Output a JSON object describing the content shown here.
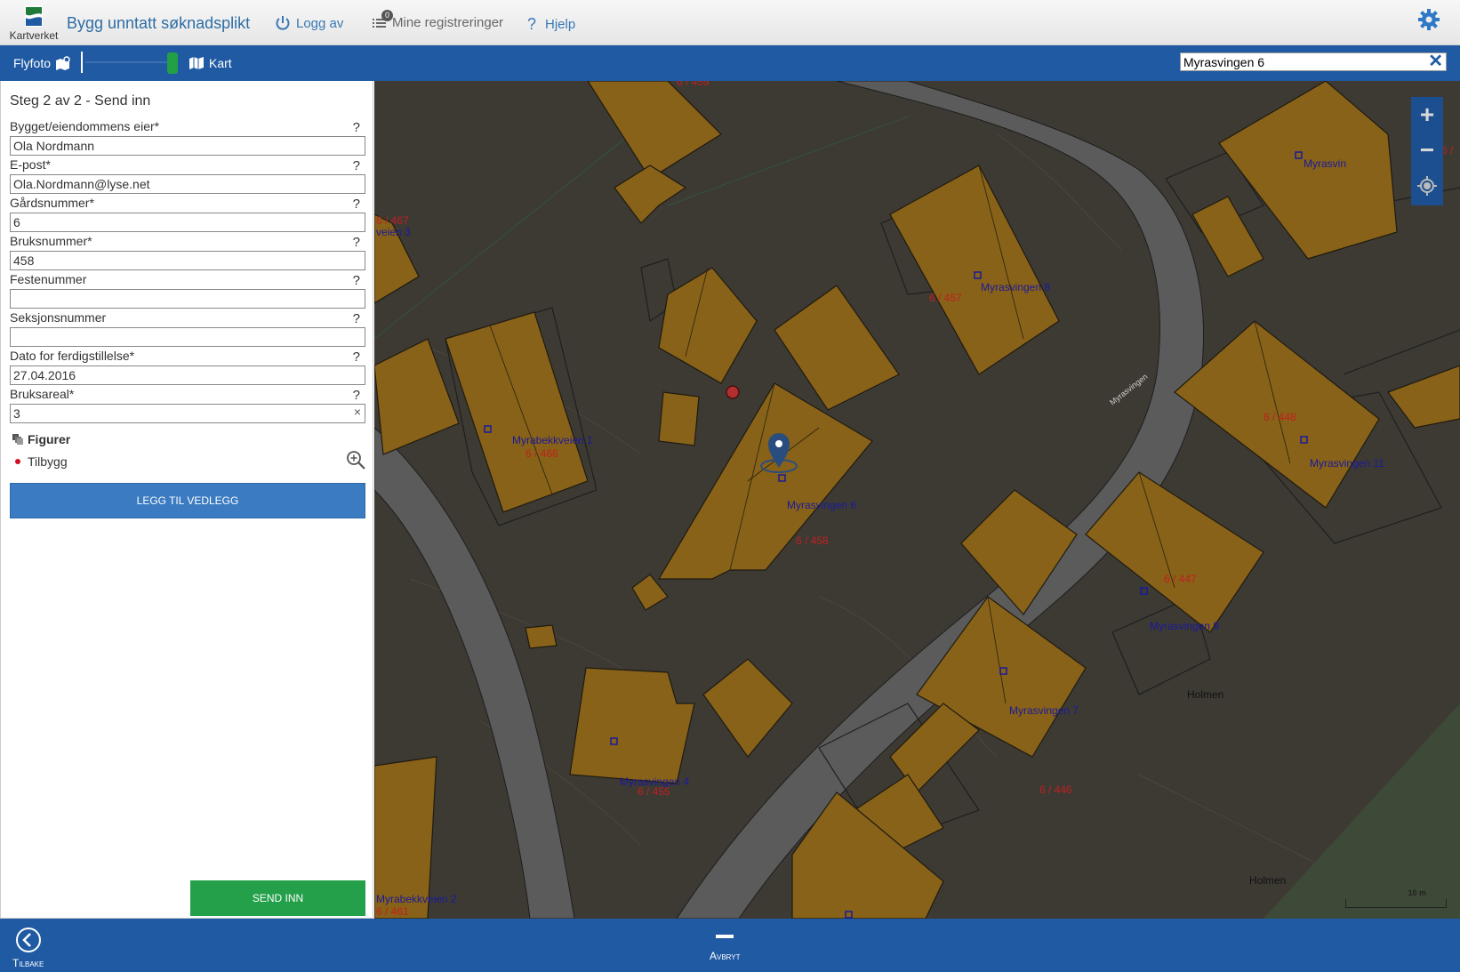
{
  "header": {
    "logo_text": "Kartverket",
    "app_title": "Bygg unntatt søknadsplikt",
    "nav": {
      "logout": "Logg av",
      "registrations": "Mine registreringer",
      "registrations_count": "0",
      "help": "Hjelp"
    }
  },
  "toolbar": {
    "flyfoto": "Flyfoto",
    "kart": "Kart",
    "search_value": "Myrasvingen 6"
  },
  "form": {
    "step_title": "Steg 2 av 2 - Send inn",
    "fields": [
      {
        "label": "Bygget/eiendommens eier*",
        "value": "Ola Nordmann"
      },
      {
        "label": "E-post*",
        "value": "Ola.Nordmann@lyse.net"
      },
      {
        "label": "Gårdsnummer*",
        "value": "6"
      },
      {
        "label": "Bruksnummer*",
        "value": "458"
      },
      {
        "label": "Festenummer",
        "value": ""
      },
      {
        "label": "Seksjonsnummer",
        "value": ""
      },
      {
        "label": "Dato for ferdigstillelse*",
        "value": "27.04.2016"
      },
      {
        "label": "Bruksareal*",
        "value": "3"
      }
    ],
    "help_mark": "?",
    "clear_mark": "×",
    "figures_title": "Figurer",
    "figure_item": "Tilbygg",
    "attach_button": "LEGG TIL VEDLEGG",
    "send_button": "SEND INN"
  },
  "map": {
    "labels": {
      "l1": "6 / 459",
      "l2": "6 / 467",
      "l3": "veien 3",
      "l4": "Myrasvingen 8",
      "l5": "6 / 457",
      "l6": "Myrasvin",
      "l7": "6 /",
      "l8": "Myrabekkveien 1",
      "l9": "6 / 466",
      "l10": "Myrasvingen",
      "l11": "6 / 448",
      "l12": "Myrasvingen 11",
      "l13": "Myrasvingen 6",
      "l14": "6 / 458",
      "l15": "6 / 447",
      "l16": "Myrasvingen 9",
      "l17": "Holmen",
      "l18": "Myrasvingen 7",
      "l19": "Myrasvingen 4",
      "l20": "6 / 455",
      "l21": "6 / 446",
      "l22": "Holmen",
      "l23": "Myrabekkveien 2",
      "l24": "6 / 461"
    },
    "zoom_in": "+",
    "zoom_out": "−",
    "scale_label": "10 m"
  },
  "bottom": {
    "back": "Tilbake",
    "cancel": "Avbryt"
  },
  "colors": {
    "brand_blue": "#1f5aa3",
    "send_green": "#24a04a",
    "attach_blue": "#3a7bc1",
    "building": "#8a6418",
    "parcel_red": "#c02020",
    "address_blue": "#1a1a9a"
  }
}
